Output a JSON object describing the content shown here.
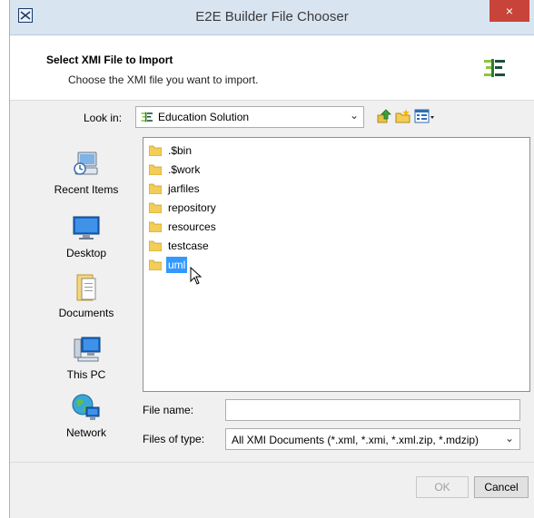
{
  "window": {
    "title": "E2E Builder File Chooser",
    "close_glyph": "×",
    "app_icon": "app-window-icon"
  },
  "header": {
    "title": "Select XMI File to Import",
    "subtitle": "Choose the XMI file you want to import.",
    "logo": "e2e-builder-logo"
  },
  "lookin": {
    "label": "Look in:",
    "value": "Education Solution",
    "toolbar_icons": [
      "up-one-level-icon",
      "create-new-folder-icon",
      "view-menu-icon"
    ]
  },
  "places": [
    {
      "label": "Recent Items",
      "icon": "recent-items-icon"
    },
    {
      "label": "Desktop",
      "icon": "desktop-icon"
    },
    {
      "label": "Documents",
      "icon": "documents-icon"
    },
    {
      "label": "This PC",
      "icon": "this-pc-icon"
    },
    {
      "label": "Network",
      "icon": "network-icon"
    }
  ],
  "files": [
    {
      "name": ".$bin",
      "selected": false
    },
    {
      "name": ".$work",
      "selected": false
    },
    {
      "name": "jarfiles",
      "selected": false
    },
    {
      "name": "repository",
      "selected": false
    },
    {
      "name": "resources",
      "selected": false
    },
    {
      "name": "testcase",
      "selected": false
    },
    {
      "name": "uml",
      "selected": true
    }
  ],
  "form": {
    "file_name_label": "File name:",
    "file_name_value": "",
    "files_of_type_label": "Files of type:",
    "files_of_type_value": "All XMI Documents (*.xml, *.xmi, *.xml.zip, *.mdzip)"
  },
  "buttons": {
    "ok": "OK",
    "cancel": "Cancel"
  },
  "colors": {
    "selection": "#3399ff",
    "close_button": "#c8443a",
    "title_bar": "#d9e4f1"
  }
}
